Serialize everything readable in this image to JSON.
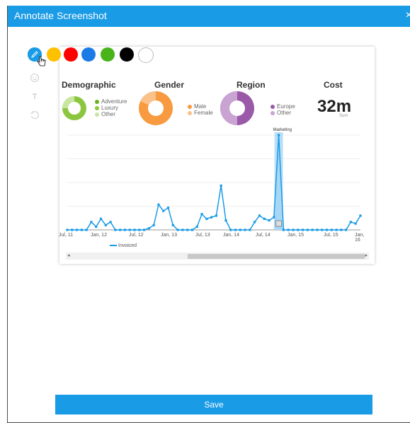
{
  "dialog": {
    "title": "Annotate Screenshot",
    "close_glyph": "×"
  },
  "toolbar": {
    "colors": [
      "#1a9be6",
      "#ffc000",
      "#ff0000",
      "#1a7be6",
      "#49b41a",
      "#000000",
      "#ffffff"
    ],
    "tools": [
      {
        "name": "pencil-icon"
      },
      {
        "name": "smiley-icon"
      },
      {
        "name": "text-icon",
        "glyph": "T"
      },
      {
        "name": "undo-icon"
      }
    ]
  },
  "dashboard": {
    "demographic": {
      "title": "Demographic",
      "legend": [
        "Adventure",
        "Luxury",
        "Other"
      ]
    },
    "gender": {
      "title": "Gender",
      "legend": [
        "Male",
        "Female"
      ]
    },
    "region": {
      "title": "Region",
      "legend": [
        "Europe",
        "Other"
      ]
    },
    "cost": {
      "title": "Cost",
      "value": "32m",
      "sub": "Sum"
    },
    "chart": {
      "annotation": "Marketing",
      "series_name": "Invoiced",
      "ticks": [
        "Jul, 11",
        "Jan, 12",
        "Jul, 12",
        "Jan, 13",
        "Jul, 13",
        "Jan, 14",
        "Jul, 14",
        "Jan, 15",
        "Jul, 15",
        "Jan, 16"
      ]
    }
  },
  "chart_data": {
    "type": "line",
    "title": "",
    "xlabel": "",
    "ylabel": "",
    "series": [
      {
        "name": "Invoiced",
        "values": [
          0,
          0,
          0,
          0,
          0,
          5,
          2,
          7,
          3,
          5,
          0,
          0,
          0,
          0,
          0,
          0,
          0,
          1,
          3,
          16,
          12,
          14,
          3,
          0,
          0,
          0,
          0,
          2,
          10,
          7,
          8,
          9,
          28,
          6,
          0,
          0,
          0,
          0,
          0,
          5,
          9,
          7,
          6,
          8,
          60,
          0,
          0,
          0,
          0,
          0,
          0,
          0,
          0,
          0,
          0,
          0,
          0,
          0,
          0,
          5,
          4,
          9
        ]
      }
    ],
    "x_ticks": [
      "Jul, 11",
      "Jan, 12",
      "Jul, 12",
      "Jan, 13",
      "Jul, 13",
      "Jan, 14",
      "Jul, 14",
      "Jan, 15",
      "Jul, 15",
      "Jan, 16"
    ],
    "highlight": "Marketing",
    "colors": {
      "line": "#1a9be6",
      "highlight": "#b9dff7"
    }
  },
  "footer": {
    "save_label": "Save"
  }
}
